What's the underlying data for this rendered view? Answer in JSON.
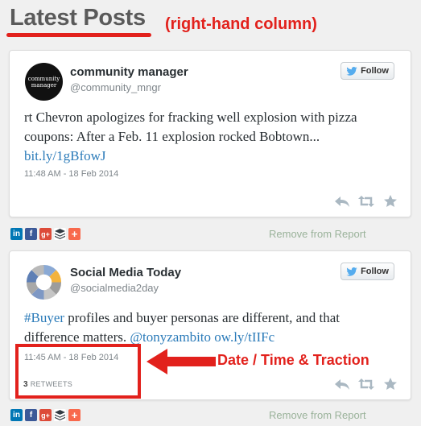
{
  "header": {
    "title": "Latest Posts",
    "column_note": "(right-hand column)"
  },
  "posts": [
    {
      "name": "community manager",
      "handle": "@community_mngr",
      "avatar_text": "community manager",
      "follow_label": "Follow",
      "text_plain": "rt Chevron apologizes for fracking well explosion with pizza coupons: After a Feb. 11 explosion rocked Bobtown... ",
      "text_link": "bit.ly/1gBfowJ",
      "timestamp": "11:48 AM - 18 Feb 2014",
      "remove_label": "Remove from Report"
    },
    {
      "name": "Social Media Today",
      "handle": "@socialmedia2day",
      "follow_label": "Follow",
      "hashtag": "#Buyer",
      "text_plain_1": " profiles and buyer personas are different, and that difference matters. ",
      "mention": "@tonyzambito",
      "text_link": "ow.ly/tIIFc",
      "timestamp": "11:45 AM - 18 Feb 2014",
      "retweet_count": "3",
      "retweet_label": "RETWEETS",
      "remove_label": "Remove from Report"
    }
  ],
  "annotation": {
    "date_traction": "Date / Time & Traction"
  },
  "share_icons": [
    "in",
    "f",
    "g+",
    "buffer",
    "+"
  ],
  "colors": {
    "accent_red": "#e2211c",
    "link_blue": "#2b7bb9",
    "linkedin": "#0077b5",
    "facebook": "#3b5998",
    "googleplus": "#dd4b39",
    "buffer": "#323b43",
    "addthis": "#f8694d"
  }
}
